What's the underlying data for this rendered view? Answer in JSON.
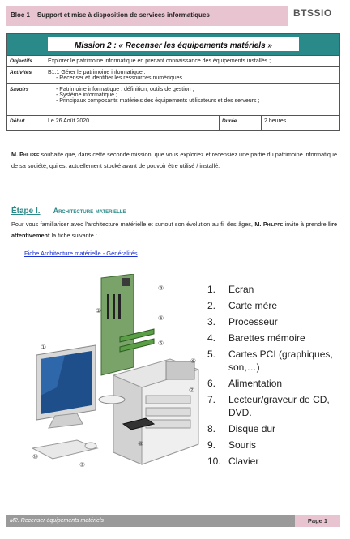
{
  "header": {
    "title": "Bloc 1 – Support et mise à disposition de services informatiques",
    "logo": "BTSSIO"
  },
  "mission": {
    "number": "Mission 2",
    "title": " : « Recenser les équipements matériels  »"
  },
  "table": {
    "objectifs_label": "Objectifs",
    "objectifs": "Explorer le patrimoine informatique en prenant connaissance des équipements installés ;",
    "activites_label": "Activités",
    "activites_line1": "B1.1 Gérer le patrimoine informatique :",
    "activites_line2": "Recenser et identifier les ressources numériques.",
    "savoirs_label": "Savoirs",
    "savoirs": [
      "Patrimoine informatique : définition, outils de gestion ;",
      "Système informatique ;",
      "Principaux composants matériels des équipements utilisateurs et des serveurs ;"
    ],
    "debut_label": "Début",
    "debut": "Le 26 Août 2020",
    "duree_label": "Durée",
    "duree": "2 heures"
  },
  "intro": {
    "name": "M. Philippe",
    "text": " souhaite que, dans cette seconde mission, que vous exploriez et recensiez une partie du patrimoine informatique de sa société, qui est actuellement stocké avant de pouvoir être utilisé / installé."
  },
  "etape": {
    "label": "Étape I.",
    "title": "Architecture materielle"
  },
  "etape_text": {
    "part1": "Pour vous familiariser avec l'architecture matérielle et surtout son évolution au fil des âges, ",
    "name": "M. Philippe",
    "part2": " invite à prendre ",
    "bold": "lire attentivement",
    "part3": " la fiche suivante :"
  },
  "link": "Fiche Architecture matérielle - Généralités",
  "figure_callouts": [
    "①",
    "②",
    "③",
    "④",
    "⑤",
    "⑥",
    "⑦",
    "⑧",
    "⑨",
    "⑩"
  ],
  "legend": [
    {
      "n": "1.",
      "label": "Ecran"
    },
    {
      "n": "2.",
      "label": "Carte mère"
    },
    {
      "n": "3.",
      "label": "Processeur"
    },
    {
      "n": "4.",
      "label": "Barettes mémoire"
    },
    {
      "n": "5.",
      "label": "Cartes PCI (graphiques, son,…)"
    },
    {
      "n": "6.",
      "label": "Alimentation"
    },
    {
      "n": "7.",
      "label": "Lecteur/graveur de CD, DVD."
    },
    {
      "n": "8.",
      "label": "Disque dur"
    },
    {
      "n": "9.",
      "label": "Souris"
    },
    {
      "n": "10.",
      "label": "Clavier"
    }
  ],
  "footer": {
    "left": "M2. Recenser équipements matériels",
    "page": "Page 1"
  }
}
